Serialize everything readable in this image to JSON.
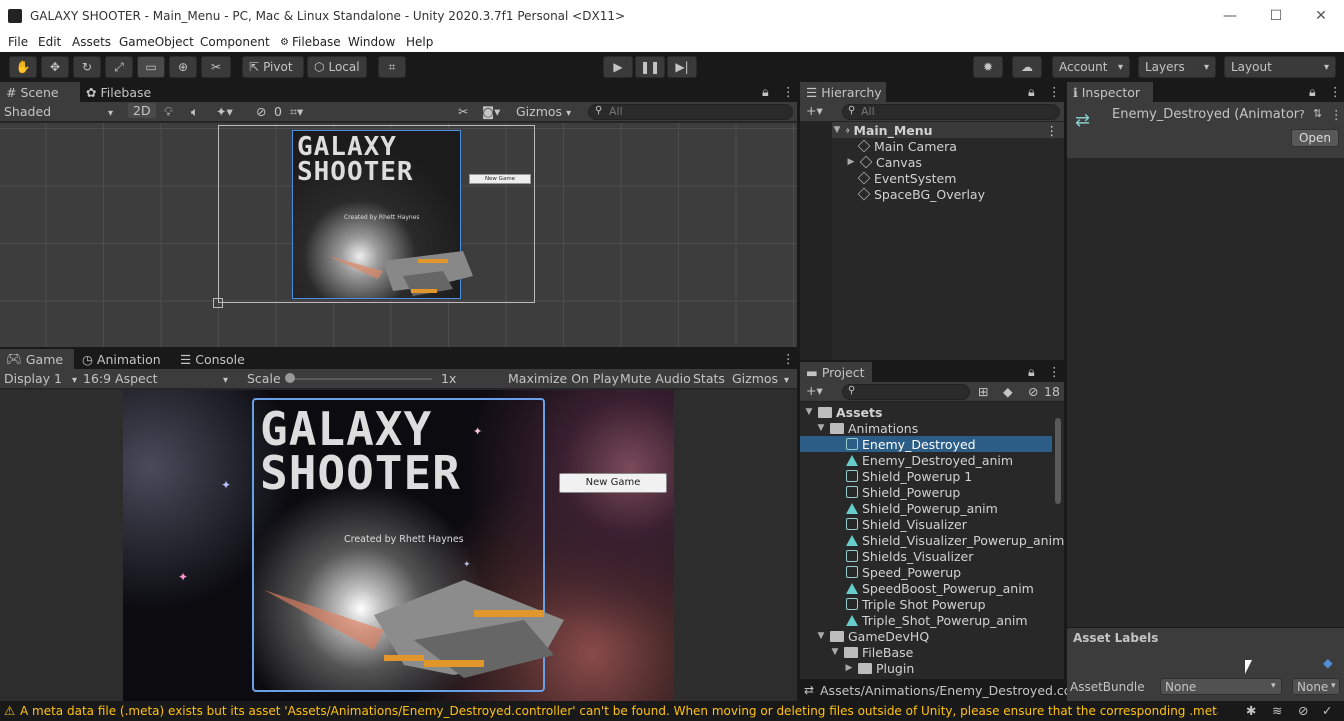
{
  "window": {
    "title": "GALAXY SHOOTER - Main_Menu - PC, Mac & Linux Standalone - Unity 2020.3.7f1 Personal <DX11>",
    "minimize": "—",
    "maximize": "☐",
    "close": "✕"
  },
  "menu": [
    "File",
    "Edit",
    "Assets",
    "GameObject",
    "Component",
    "Filebase",
    "Window",
    "Help"
  ],
  "toolbar": {
    "pivot": "Pivot",
    "local": "Local",
    "account": "Account",
    "layers": "Layers",
    "layout": "Layout"
  },
  "scene": {
    "tabs": [
      "Scene",
      "Filebase"
    ],
    "shading": "Shaded",
    "mode2d": "2D",
    "hidden_count": "0",
    "gizmos": "Gizmos",
    "search_placeholder": "All",
    "game_title_line1": "GALAXY",
    "game_title_line2": "SHOOTER",
    "credit": "Created by Rhett Haynes",
    "new_game": "New Game"
  },
  "game": {
    "tabs": [
      "Game",
      "Animation",
      "Console"
    ],
    "display": "Display 1",
    "aspect": "16:9 Aspect",
    "scale_label": "Scale",
    "scale_value": "1x",
    "scale_fraction": 0,
    "maximize": "Maximize On Play",
    "mute": "Mute Audio",
    "stats": "Stats",
    "gizmos": "Gizmos"
  },
  "hierarchy": {
    "tab": "Hierarchy",
    "search_placeholder": "All",
    "scene": "Main_Menu",
    "items": [
      "Main Camera",
      "Canvas",
      "EventSystem",
      "SpaceBG_Overlay"
    ]
  },
  "project": {
    "tab": "Project",
    "hidden_count": "18",
    "root": "Assets",
    "folder": "Animations",
    "items": [
      {
        "name": "Enemy_Destroyed",
        "kind": "controller",
        "selected": true
      },
      {
        "name": "Enemy_Destroyed_anim",
        "kind": "clip"
      },
      {
        "name": "Shield_Powerup 1",
        "kind": "controller"
      },
      {
        "name": "Shield_Powerup",
        "kind": "controller"
      },
      {
        "name": "Shield_Powerup_anim",
        "kind": "clip"
      },
      {
        "name": "Shield_Visualizer",
        "kind": "controller"
      },
      {
        "name": "Shield_Visualizer_Powerup_anim",
        "kind": "clip"
      },
      {
        "name": "Shields_Visualizer",
        "kind": "controller"
      },
      {
        "name": "Speed_Powerup",
        "kind": "controller"
      },
      {
        "name": "SpeedBoost_Powerup_anim",
        "kind": "clip"
      },
      {
        "name": "Triple Shot Powerup",
        "kind": "controller"
      },
      {
        "name": "Triple_Shot_Powerup_anim",
        "kind": "clip"
      }
    ],
    "folder2": "GameDevHQ",
    "folder3": "FileBase",
    "folder4": "Plugin",
    "path": "Assets/Animations/Enemy_Destroyed.contr"
  },
  "inspector": {
    "tab": "Inspector",
    "object_name": "Enemy_Destroyed (Animator",
    "open": "Open",
    "asset_labels": "Asset Labels",
    "asset_bundle_label": "AssetBundle",
    "asset_bundle_value": "None",
    "asset_variant_value": "None"
  },
  "status": {
    "message": "A meta data file (.meta) exists but its asset 'Assets/Animations/Enemy_Destroyed.controller' can't be found. When moving or deleting files outside of Unity, please ensure that the corresponding .meta file is moved or de"
  },
  "colors": {
    "selection": "#2c5d87",
    "warning": "#ffc20e",
    "frame": "#4a90e2"
  }
}
